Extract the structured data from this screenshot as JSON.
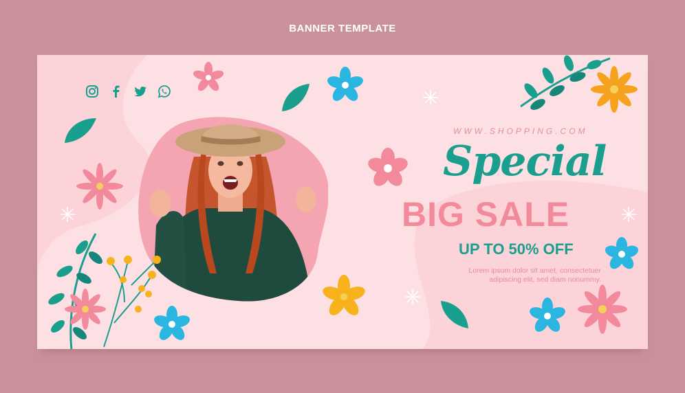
{
  "page_title": "BANNER TEMPLATE",
  "banner": {
    "url": "WWW.SHOPPING.COM",
    "headline": "Special",
    "subheadline": "BIG SALE",
    "discount": "UP TO 50% OFF",
    "body_line1": "Lorem ipsum dolor sit amet, consectetuer",
    "body_line2": "adipiscing elit, sed diam nonummy.",
    "social_icons": [
      "instagram-icon",
      "facebook-icon",
      "twitter-icon",
      "whatsapp-icon"
    ]
  },
  "colors": {
    "page_bg": "#c9929a",
    "banner_bg": "#fde0e4",
    "teal": "#1a9e8e",
    "pink": "#f28a9b",
    "blue_flower": "#2ab6e0",
    "yellow_flower": "#f7b21c"
  }
}
